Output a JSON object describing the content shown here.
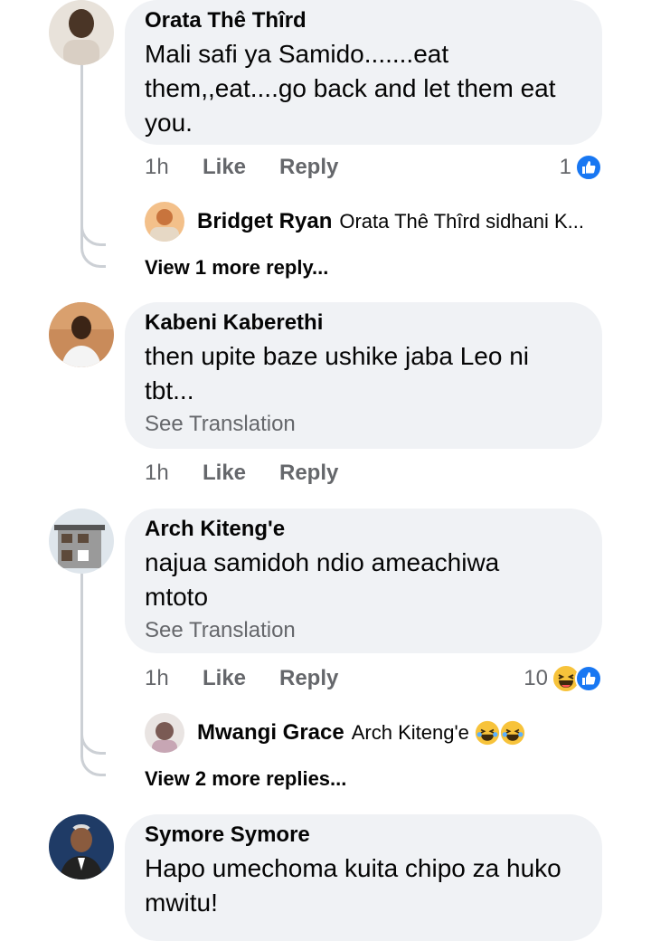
{
  "comments": [
    {
      "author": "Orata Thê Thîrd",
      "text_lines": [
        "Mali safi ya Samido.......eat",
        "them,,eat....go back and let them eat",
        "you."
      ],
      "time": "1h",
      "like_label": "Like",
      "reply_label": "Reply",
      "reaction_count": "1",
      "reactions": [
        "like-icon"
      ],
      "reply_preview": {
        "author": "Bridget Ryan",
        "text": "Orata Thê Thîrd sidhani K..."
      },
      "more_replies": "View 1 more reply..."
    },
    {
      "author": "Kabeni Kaberethi",
      "text_lines": [
        "then upite baze ushike jaba Leo ni",
        "tbt..."
      ],
      "see_translation": "See Translation",
      "time": "1h",
      "like_label": "Like",
      "reply_label": "Reply"
    },
    {
      "author": "Arch Kiteng'e",
      "text_lines": [
        "najua samidoh ndio ameachiwa",
        "mtoto"
      ],
      "see_translation": "See Translation",
      "time": "1h",
      "like_label": "Like",
      "reply_label": "Reply",
      "reaction_count": "10",
      "reactions": [
        "haha-icon",
        "like-icon"
      ],
      "reply_preview": {
        "author": "Mwangi Grace",
        "text": "Arch Kiteng'e"
      },
      "more_replies": "View 2 more replies..."
    },
    {
      "author": "Symore Symore",
      "text_lines": [
        "Hapo umechoma kuita chipo za huko",
        "mwitu!"
      ]
    }
  ],
  "colors": {
    "bubble": "#f0f2f5",
    "meta": "#65676b",
    "like_blue": "#1877f2",
    "thread_line": "#ccd0d5"
  }
}
